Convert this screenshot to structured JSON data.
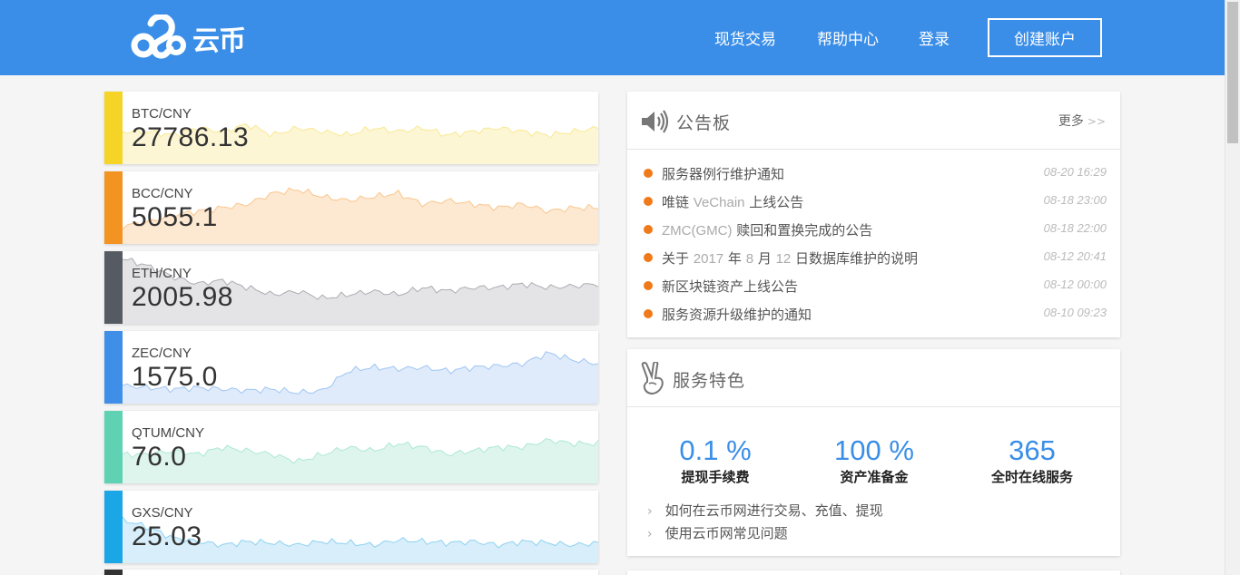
{
  "brand": {
    "name": "云币",
    "logo_icon": "cloud-s-logo-icon"
  },
  "nav": {
    "spot_trading": "现货交易",
    "help_center": "帮助中心",
    "login": "登录",
    "create_account": "创建账户"
  },
  "tickers": [
    {
      "pair": "BTC/CNY",
      "price": "27786.13",
      "color": "#f5d327",
      "fill": "#fdf6d5"
    },
    {
      "pair": "BCC/CNY",
      "price": "5055.1",
      "color": "#f39322",
      "fill": "#fde8d2"
    },
    {
      "pair": "ETH/CNY",
      "price": "2005.98",
      "color": "#565a63",
      "fill": "#e4e4e6"
    },
    {
      "pair": "ZEC/CNY",
      "price": "1575.0",
      "color": "#3f8ee8",
      "fill": "#dfebfa"
    },
    {
      "pair": "QTUM/CNY",
      "price": "76.0",
      "color": "#5fd2b3",
      "fill": "#def5ed"
    },
    {
      "pair": "GXS/CNY",
      "price": "25.03",
      "color": "#1ba7e6",
      "fill": "#d8eefa"
    }
  ],
  "announcements": {
    "icon": "speaker-icon",
    "title": "公告板",
    "more": "更多",
    "more_arrow": ">>",
    "items": [
      {
        "parts": [
          {
            "t": "服务器例行维护通知"
          }
        ],
        "date": "08-20 16:29"
      },
      {
        "parts": [
          {
            "t": "唯链 "
          },
          {
            "t": "VeChain",
            "l": 1
          },
          {
            "t": " 上线公告"
          }
        ],
        "date": "08-18 23:00"
      },
      {
        "parts": [
          {
            "t": "ZMC(GMC)",
            "l": 1
          },
          {
            "t": " 赎回和置换完成的公告"
          }
        ],
        "date": "08-18 22:00"
      },
      {
        "parts": [
          {
            "t": "关于 "
          },
          {
            "t": "2017",
            "l": 1
          },
          {
            "t": " 年 "
          },
          {
            "t": "8",
            "l": 1
          },
          {
            "t": " 月 "
          },
          {
            "t": "12",
            "l": 1
          },
          {
            "t": " 日数据库维护的说明"
          }
        ],
        "date": "08-12 20:41"
      },
      {
        "parts": [
          {
            "t": "新区块链资产上线公告"
          }
        ],
        "date": "08-12 00:00"
      },
      {
        "parts": [
          {
            "t": "服务资源升级维护的通知"
          }
        ],
        "date": "08-10 09:23"
      }
    ]
  },
  "features": {
    "icon": "victory-hand-icon",
    "title": "服务特色",
    "stats": [
      {
        "value": "0.1 %",
        "label": "提现手续费"
      },
      {
        "value": "100 %",
        "label": "资产准备金"
      },
      {
        "value": "365",
        "label": "全时在线服务"
      }
    ],
    "links": [
      "如何在云币网进行交易、充值、提现",
      "使用云币网常见问题"
    ],
    "chevron": "›"
  }
}
